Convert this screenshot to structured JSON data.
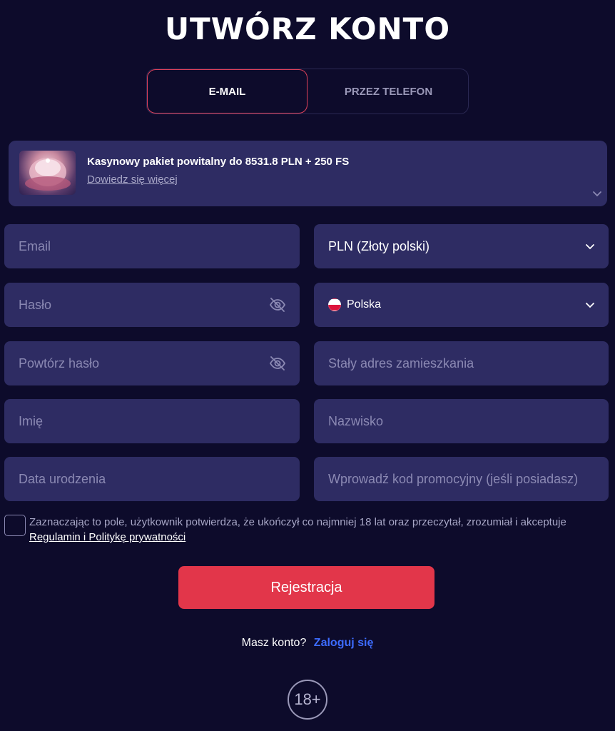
{
  "title": "UTWÓRZ KONTO",
  "tabs": {
    "email": "E-MAIL",
    "phone": "PRZEZ TELEFON"
  },
  "bonus": {
    "title": "Kasynowy pakiet powitalny do 8531.8 PLN + 250 FS",
    "link": "Dowiedz się więcej"
  },
  "form": {
    "email_placeholder": "Email",
    "currency": "PLN (Złoty polski)",
    "password_placeholder": "Hasło",
    "country": "Polska",
    "repeat_password_placeholder": "Powtórz hasło",
    "address_placeholder": "Stały adres zamieszkania",
    "first_name_placeholder": "Imię",
    "last_name_placeholder": "Nazwisko",
    "birthdate_placeholder": "Data urodzenia",
    "promo_placeholder": "Wprowadź kod promocyjny (jeśli posiadasz)"
  },
  "consent": {
    "text": "Zaznaczając to pole, użytkownik potwierdza, że ukończył co najmniej 18 lat oraz przeczytał, zrozumiał i akceptuje",
    "link": "Regulamin i Politykę prywatności"
  },
  "register_label": "Rejestracja",
  "login": {
    "question": "Masz konto?",
    "link": "Zaloguj się"
  },
  "age_badge": "18+",
  "colors": {
    "background": "#0d0b2b",
    "field": "#2e2c63",
    "accent": "#e2364a",
    "link": "#3d6cff"
  }
}
